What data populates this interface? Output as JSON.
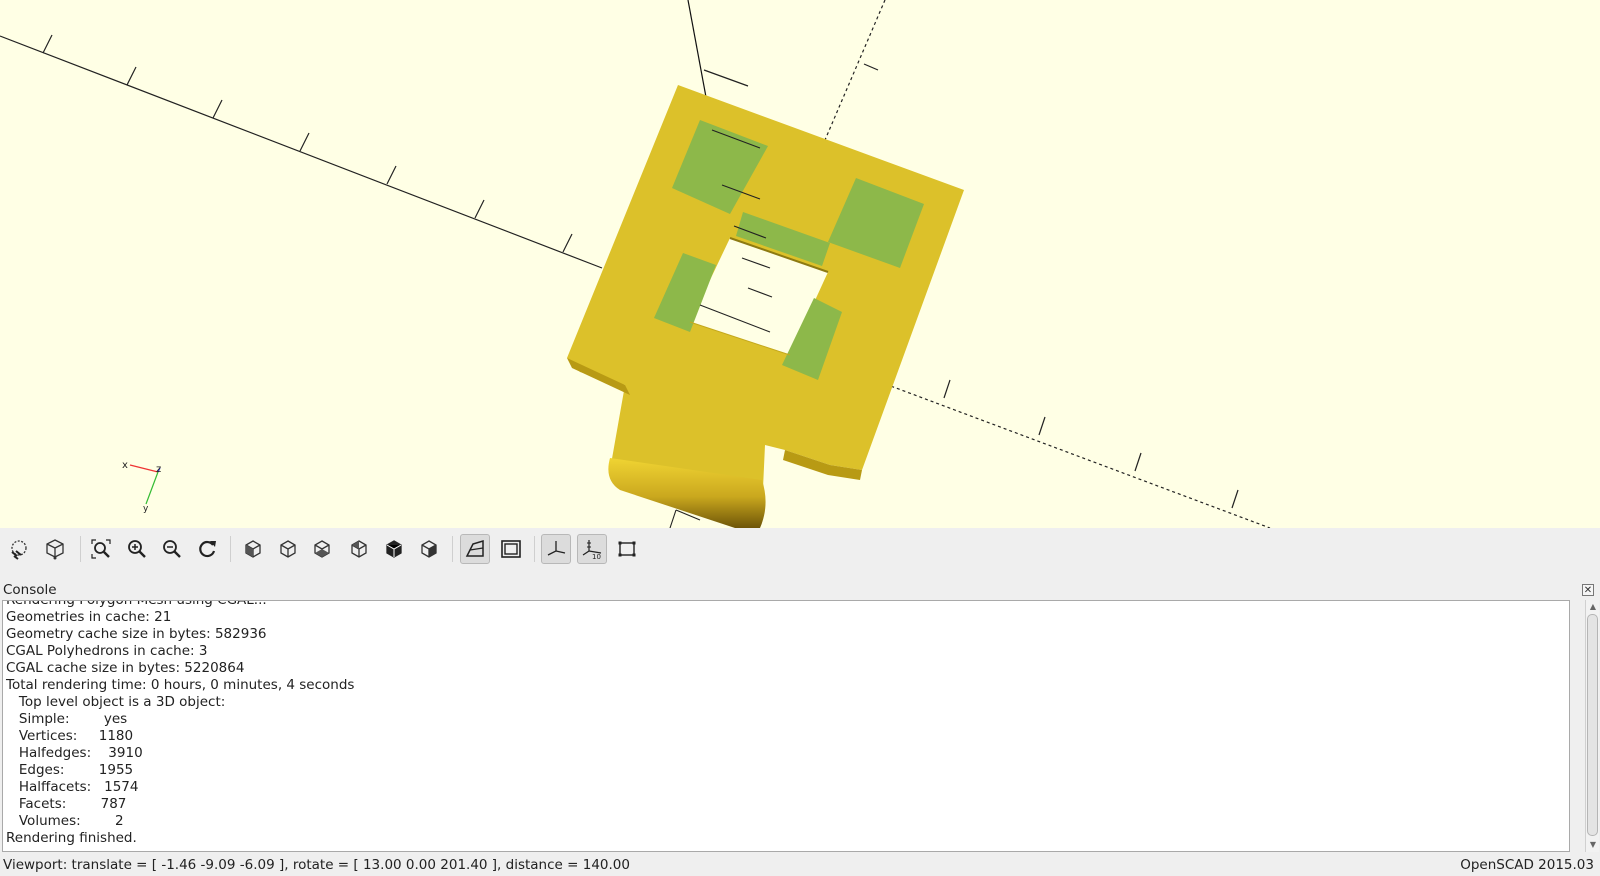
{
  "toolbar": {
    "buttons": [
      {
        "icon": "preview-icon"
      },
      {
        "icon": "render-icon"
      },
      {
        "icon": "view-all-icon"
      },
      {
        "icon": "zoom-in-icon"
      },
      {
        "icon": "zoom-out-icon"
      },
      {
        "icon": "reset-view-icon"
      },
      {
        "icon": "view-right-icon"
      },
      {
        "icon": "view-top-icon"
      },
      {
        "icon": "view-bottom-icon"
      },
      {
        "icon": "view-left-icon"
      },
      {
        "icon": "view-front-icon"
      },
      {
        "icon": "view-back-icon"
      },
      {
        "icon": "perspective-icon",
        "active": true
      },
      {
        "icon": "orthogonal-icon"
      },
      {
        "icon": "show-axes-icon",
        "active": true
      },
      {
        "icon": "show-scale-markers-icon",
        "active": true
      },
      {
        "icon": "show-edges-icon"
      }
    ]
  },
  "axes_indicator": {
    "x_label": "x",
    "z_label": "z",
    "y_label": "y"
  },
  "console": {
    "title": "Console",
    "lines": [
      "Rendering Polygon Mesh using CGAL...",
      "Geometries in cache: 21",
      "Geometry cache size in bytes: 582936",
      "CGAL Polyhedrons in cache: 3",
      "CGAL cache size in bytes: 5220864",
      "Total rendering time: 0 hours, 0 minutes, 4 seconds",
      "   Top level object is a 3D object:",
      "   Simple:        yes",
      "   Vertices:     1180",
      "   Halfedges:    3910",
      "   Edges:        1955",
      "   Halffacets:   1574",
      "   Facets:        787",
      "   Volumes:        2",
      "Rendering finished."
    ]
  },
  "status": {
    "viewport": "Viewport: translate = [ -1.46 -9.09 -6.09 ], rotate = [ 13.00 0.00 201.40 ], distance = 140.00",
    "version": "OpenSCAD 2015.03"
  },
  "colors": {
    "viewport_bg": "#ffffe5",
    "model_yellow": "#dcc12a",
    "model_green": "#8db84a"
  }
}
